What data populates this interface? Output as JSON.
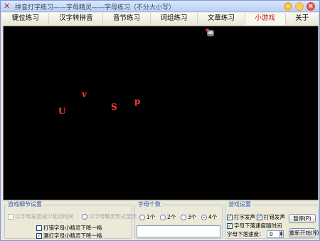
{
  "window": {
    "title": "拼音打字练习——字母精灵——字母练习（不分大小写）",
    "buttons": {
      "minimize": "–",
      "maximize": "□",
      "close": "×"
    }
  },
  "tabs": [
    {
      "label": "键位练习",
      "active": false
    },
    {
      "label": "汉字转拼音",
      "active": false
    },
    {
      "label": "音节练习",
      "active": false
    },
    {
      "label": "词组练习",
      "active": false
    },
    {
      "label": "文章练习",
      "active": false
    },
    {
      "label": "小游戏",
      "active": true
    },
    {
      "label": "关于",
      "active": false
    }
  ],
  "game": {
    "letters": [
      {
        "char": "v",
        "color": "#ff3a2a"
      },
      {
        "char": "U",
        "color": "#ff3a2a"
      },
      {
        "char": "S",
        "color": "#ff3a2a"
      },
      {
        "char": "p",
        "color": "#ff3a2a"
      }
    ],
    "sprite_icon": "gear-icon"
  },
  "settings_panel": {
    "legend": "游戏细节设置",
    "disabled_option_1": "以字母发音减少延迟时间",
    "disabled_option_2": "以字母精灵形式显示",
    "option_1": "打错字母小精灵下降一格",
    "option_2": "漏打字母小精灵下降一格"
  },
  "speed_panel": {
    "legend": "字母个数",
    "options": [
      {
        "label": "1个",
        "checked": false
      },
      {
        "label": "2个",
        "checked": false
      },
      {
        "label": "3个",
        "checked": false
      },
      {
        "label": "4个",
        "checked": true
      }
    ]
  },
  "game_panel": {
    "legend": "游戏设置",
    "opt_typing_sound": "打字发声",
    "opt_error_sound": "打错发声",
    "opt_speed_with_time": "字母下落速度随时间",
    "speed_label": "字母下落速度：",
    "speed_value": "0",
    "pause_button": "暂停(P)",
    "restart_button": "重新开始(N)"
  }
}
